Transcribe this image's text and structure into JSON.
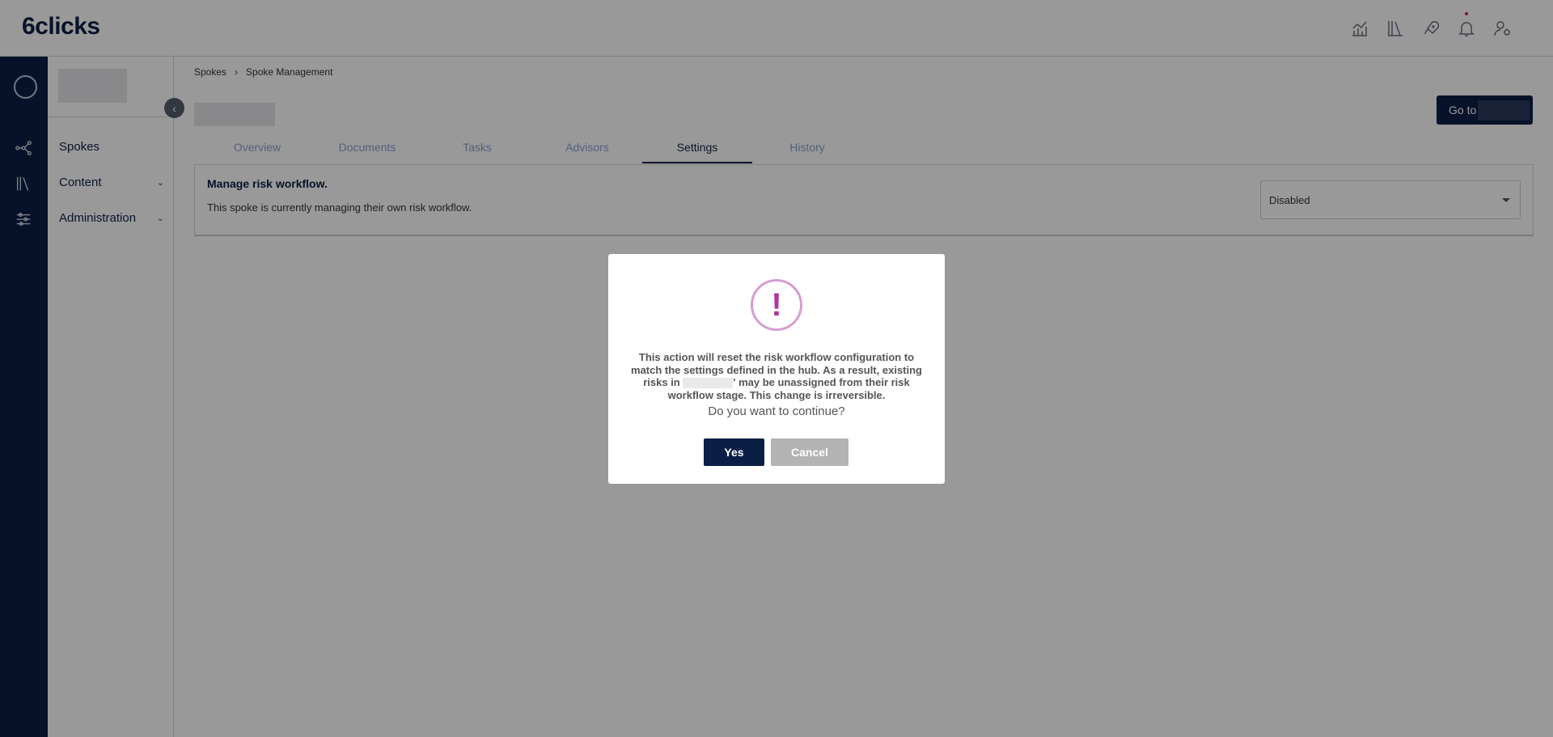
{
  "header": {
    "logo": "6clicks",
    "icons": [
      "analytics-icon",
      "library-icon",
      "rocket-icon",
      "bell-icon",
      "user-settings-icon"
    ]
  },
  "rail": {
    "icons": [
      "network-icon",
      "library-icon",
      "sliders-icon"
    ]
  },
  "sidebar": {
    "items": [
      {
        "label": "Spokes",
        "has_chevron": false
      },
      {
        "label": "Content",
        "has_chevron": true
      },
      {
        "label": "Administration",
        "has_chevron": true
      }
    ]
  },
  "breadcrumb": {
    "items": [
      "Spokes",
      "Spoke Management"
    ],
    "separator": "›"
  },
  "goto_button": {
    "label": "Go to"
  },
  "tabs": [
    "Overview",
    "Documents",
    "Tasks",
    "Advisors",
    "Settings",
    "History"
  ],
  "active_tab": "Settings",
  "card": {
    "title": "Manage risk workflow.",
    "description": "This spoke is currently managing their own risk workflow.",
    "select_value": "Disabled"
  },
  "modal": {
    "icon": "exclamation-icon",
    "message_part1": "This action will reset the risk workflow configuration to match the settings defined in the hub. As a result, existing risks in",
    "message_part2": "' may be unassigned from their risk workflow stage. This change is irreversible.",
    "question": "Do you want to continue?",
    "yes_label": "Yes",
    "cancel_label": "Cancel"
  },
  "colors": {
    "navy": "#0b1f45",
    "tab_inactive": "#8f9fcb",
    "alert_accent": "#b3339f",
    "cancel_gray": "#b3b3b3"
  }
}
